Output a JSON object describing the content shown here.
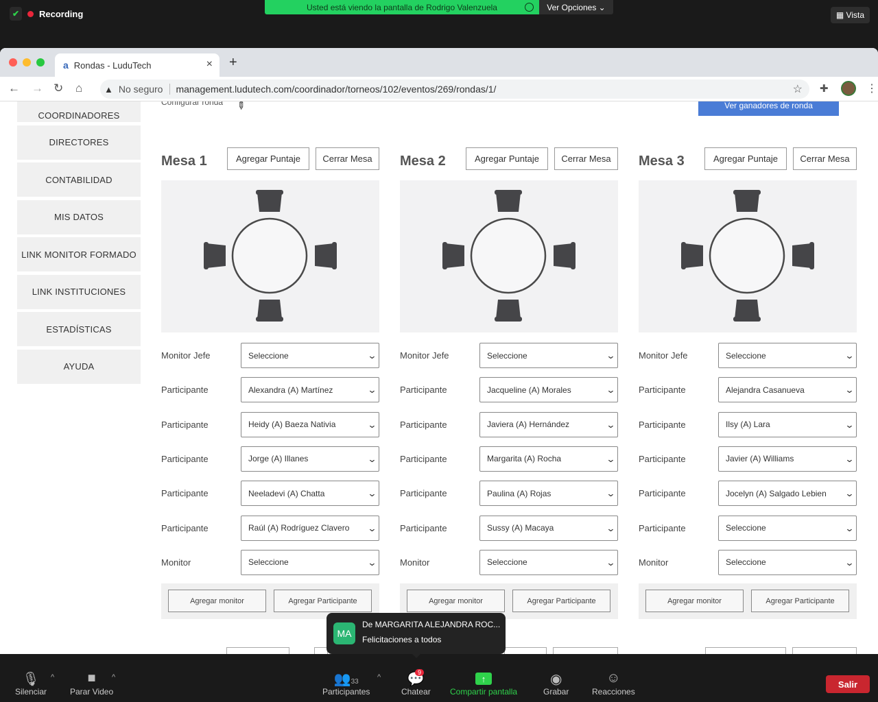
{
  "zoom": {
    "recording_label": "Recording",
    "share_banner": "Usted está viendo la pantalla de Rodrigo Valenzuela",
    "options_label": "Ver Opciones ⌄",
    "view_label": "Vista"
  },
  "browser": {
    "tab_title": "Rondas - LuduTech",
    "tab_favicon": "a",
    "not_secure": "No seguro",
    "url": "management.ludutech.com/coordinador/torneos/102/eventos/269/rondas/1/"
  },
  "sidebar": {
    "items": [
      {
        "label": "COORDINADORES"
      },
      {
        "label": "DIRECTORES"
      },
      {
        "label": "CONTABILIDAD"
      },
      {
        "label": "MIS DATOS"
      },
      {
        "label": "LINK MONITOR FORMADO"
      },
      {
        "label": "LINK INSTITUCIONES"
      },
      {
        "label": "ESTADÍSTICAS"
      },
      {
        "label": "AYUDA"
      }
    ]
  },
  "page": {
    "configurar_label": "Configurar ronda",
    "ganadores_button": "Ver ganadores de ronda",
    "add_score_label": "Agregar Puntaje",
    "close_table_label": "Cerrar Mesa",
    "add_monitor_label": "Agregar monitor",
    "add_participant_label": "Agregar Participante"
  },
  "mesas": [
    {
      "title": "Mesa 1",
      "rows": [
        {
          "label": "Monitor Jefe",
          "value": "Seleccione"
        },
        {
          "label": "Participante",
          "value": "Alexandra (A) Martínez"
        },
        {
          "label": "Participante",
          "value": "Heidy (A) Baeza Nativia"
        },
        {
          "label": "Participante",
          "value": "Jorge (A) Illanes"
        },
        {
          "label": "Participante",
          "value": "Neeladevi (A) Chatta"
        },
        {
          "label": "Participante",
          "value": "Raúl (A) Rodríguez Clavero"
        },
        {
          "label": "Monitor",
          "value": "Seleccione"
        }
      ]
    },
    {
      "title": "Mesa 2",
      "rows": [
        {
          "label": "Monitor Jefe",
          "value": "Seleccione"
        },
        {
          "label": "Participante",
          "value": "Jacqueline (A) Morales"
        },
        {
          "label": "Participante",
          "value": "Javiera (A) Hernández"
        },
        {
          "label": "Participante",
          "value": "Margarita (A) Rocha"
        },
        {
          "label": "Participante",
          "value": "Paulina (A) Rojas"
        },
        {
          "label": "Participante",
          "value": "Sussy (A) Macaya"
        },
        {
          "label": "Monitor",
          "value": "Seleccione"
        }
      ]
    },
    {
      "title": "Mesa 3",
      "rows": [
        {
          "label": "Monitor Jefe",
          "value": "Seleccione"
        },
        {
          "label": "Participante",
          "value": "Alejandra Casanueva"
        },
        {
          "label": "Participante",
          "value": "Ilsy (A) Lara"
        },
        {
          "label": "Participante",
          "value": "Javier (A) Williams"
        },
        {
          "label": "Participante",
          "value": "Jocelyn (A) Salgado Lebien"
        },
        {
          "label": "Participante",
          "value": "Seleccione"
        },
        {
          "label": "Monitor",
          "value": "Seleccione"
        }
      ]
    }
  ],
  "chat_toast": {
    "initials": "MA",
    "from": "De MARGARITA ALEJANDRA ROC...",
    "message": "Felicitaciones a todos"
  },
  "controls": {
    "mute": "Silenciar",
    "video": "Parar Video",
    "participants": "Participantes",
    "participants_count": "33",
    "chat": "Chatear",
    "chat_badge": "9",
    "share": "Compartir pantalla",
    "record": "Grabar",
    "reactions": "Reacciones",
    "leave": "Salir"
  },
  "colors": {
    "share_green": "#23d160",
    "leave_red": "#c9262f",
    "ganadores_blue": "#4a7cd6"
  }
}
